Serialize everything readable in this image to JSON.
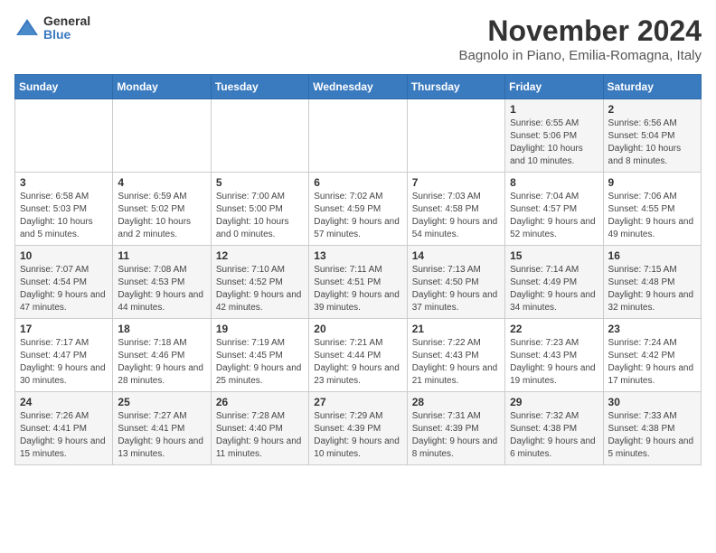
{
  "logo": {
    "general": "General",
    "blue": "Blue"
  },
  "title": "November 2024",
  "location": "Bagnolo in Piano, Emilia-Romagna, Italy",
  "days_of_week": [
    "Sunday",
    "Monday",
    "Tuesday",
    "Wednesday",
    "Thursday",
    "Friday",
    "Saturday"
  ],
  "weeks": [
    [
      {
        "day": "",
        "info": ""
      },
      {
        "day": "",
        "info": ""
      },
      {
        "day": "",
        "info": ""
      },
      {
        "day": "",
        "info": ""
      },
      {
        "day": "",
        "info": ""
      },
      {
        "day": "1",
        "info": "Sunrise: 6:55 AM\nSunset: 5:06 PM\nDaylight: 10 hours and 10 minutes."
      },
      {
        "day": "2",
        "info": "Sunrise: 6:56 AM\nSunset: 5:04 PM\nDaylight: 10 hours and 8 minutes."
      }
    ],
    [
      {
        "day": "3",
        "info": "Sunrise: 6:58 AM\nSunset: 5:03 PM\nDaylight: 10 hours and 5 minutes."
      },
      {
        "day": "4",
        "info": "Sunrise: 6:59 AM\nSunset: 5:02 PM\nDaylight: 10 hours and 2 minutes."
      },
      {
        "day": "5",
        "info": "Sunrise: 7:00 AM\nSunset: 5:00 PM\nDaylight: 10 hours and 0 minutes."
      },
      {
        "day": "6",
        "info": "Sunrise: 7:02 AM\nSunset: 4:59 PM\nDaylight: 9 hours and 57 minutes."
      },
      {
        "day": "7",
        "info": "Sunrise: 7:03 AM\nSunset: 4:58 PM\nDaylight: 9 hours and 54 minutes."
      },
      {
        "day": "8",
        "info": "Sunrise: 7:04 AM\nSunset: 4:57 PM\nDaylight: 9 hours and 52 minutes."
      },
      {
        "day": "9",
        "info": "Sunrise: 7:06 AM\nSunset: 4:55 PM\nDaylight: 9 hours and 49 minutes."
      }
    ],
    [
      {
        "day": "10",
        "info": "Sunrise: 7:07 AM\nSunset: 4:54 PM\nDaylight: 9 hours and 47 minutes."
      },
      {
        "day": "11",
        "info": "Sunrise: 7:08 AM\nSunset: 4:53 PM\nDaylight: 9 hours and 44 minutes."
      },
      {
        "day": "12",
        "info": "Sunrise: 7:10 AM\nSunset: 4:52 PM\nDaylight: 9 hours and 42 minutes."
      },
      {
        "day": "13",
        "info": "Sunrise: 7:11 AM\nSunset: 4:51 PM\nDaylight: 9 hours and 39 minutes."
      },
      {
        "day": "14",
        "info": "Sunrise: 7:13 AM\nSunset: 4:50 PM\nDaylight: 9 hours and 37 minutes."
      },
      {
        "day": "15",
        "info": "Sunrise: 7:14 AM\nSunset: 4:49 PM\nDaylight: 9 hours and 34 minutes."
      },
      {
        "day": "16",
        "info": "Sunrise: 7:15 AM\nSunset: 4:48 PM\nDaylight: 9 hours and 32 minutes."
      }
    ],
    [
      {
        "day": "17",
        "info": "Sunrise: 7:17 AM\nSunset: 4:47 PM\nDaylight: 9 hours and 30 minutes."
      },
      {
        "day": "18",
        "info": "Sunrise: 7:18 AM\nSunset: 4:46 PM\nDaylight: 9 hours and 28 minutes."
      },
      {
        "day": "19",
        "info": "Sunrise: 7:19 AM\nSunset: 4:45 PM\nDaylight: 9 hours and 25 minutes."
      },
      {
        "day": "20",
        "info": "Sunrise: 7:21 AM\nSunset: 4:44 PM\nDaylight: 9 hours and 23 minutes."
      },
      {
        "day": "21",
        "info": "Sunrise: 7:22 AM\nSunset: 4:43 PM\nDaylight: 9 hours and 21 minutes."
      },
      {
        "day": "22",
        "info": "Sunrise: 7:23 AM\nSunset: 4:43 PM\nDaylight: 9 hours and 19 minutes."
      },
      {
        "day": "23",
        "info": "Sunrise: 7:24 AM\nSunset: 4:42 PM\nDaylight: 9 hours and 17 minutes."
      }
    ],
    [
      {
        "day": "24",
        "info": "Sunrise: 7:26 AM\nSunset: 4:41 PM\nDaylight: 9 hours and 15 minutes."
      },
      {
        "day": "25",
        "info": "Sunrise: 7:27 AM\nSunset: 4:41 PM\nDaylight: 9 hours and 13 minutes."
      },
      {
        "day": "26",
        "info": "Sunrise: 7:28 AM\nSunset: 4:40 PM\nDaylight: 9 hours and 11 minutes."
      },
      {
        "day": "27",
        "info": "Sunrise: 7:29 AM\nSunset: 4:39 PM\nDaylight: 9 hours and 10 minutes."
      },
      {
        "day": "28",
        "info": "Sunrise: 7:31 AM\nSunset: 4:39 PM\nDaylight: 9 hours and 8 minutes."
      },
      {
        "day": "29",
        "info": "Sunrise: 7:32 AM\nSunset: 4:38 PM\nDaylight: 9 hours and 6 minutes."
      },
      {
        "day": "30",
        "info": "Sunrise: 7:33 AM\nSunset: 4:38 PM\nDaylight: 9 hours and 5 minutes."
      }
    ]
  ]
}
